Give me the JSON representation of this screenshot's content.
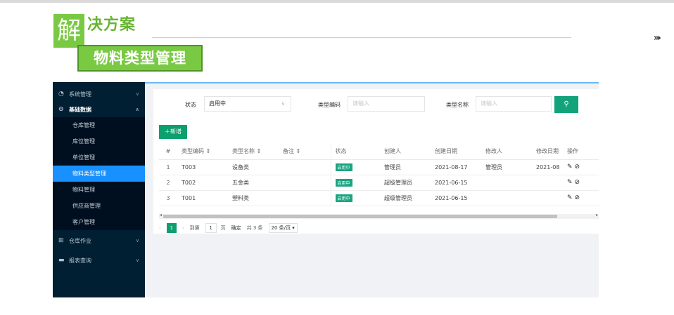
{
  "header": {
    "title_first_char": "解",
    "title_rest": "决方案",
    "subtitle": "物料类型管理",
    "expand_glyph": "»›"
  },
  "sidebar": {
    "groups": [
      {
        "label": "系统管理",
        "icon": "dashboard-icon",
        "expanded": false
      },
      {
        "label": "基础数据",
        "icon": "circle-arrow-icon",
        "expanded": true,
        "items": [
          {
            "label": "仓库管理"
          },
          {
            "label": "库位管理"
          },
          {
            "label": "单位管理"
          },
          {
            "label": "物料类型管理",
            "active": true
          },
          {
            "label": "物料管理"
          },
          {
            "label": "供应商管理"
          },
          {
            "label": "客户管理"
          }
        ]
      },
      {
        "label": "仓库作业",
        "icon": "warehouse-icon",
        "expanded": false
      },
      {
        "label": "报表查询",
        "icon": "chat-icon",
        "expanded": false
      }
    ]
  },
  "filters": {
    "status_label": "状态",
    "status_value": "启用中",
    "code_label": "类型编码",
    "code_placeholder": "请输入",
    "name_label": "类型名称",
    "name_placeholder": "请输入",
    "search_icon": "search-icon"
  },
  "toolbar": {
    "add_label": "新增"
  },
  "table": {
    "columns": {
      "index": "#",
      "code": "类型编码",
      "name": "类型名称",
      "remark": "备注",
      "status": "状态",
      "creator": "创建人",
      "created": "创建日期",
      "modifier": "修改人",
      "modified": "修改日期",
      "ops": "操作"
    },
    "sort_glyph": "⇕",
    "rows": [
      {
        "index": "1",
        "code": "T003",
        "name": "设备类",
        "remark": "",
        "status": "启用中",
        "creator": "管理员",
        "created": "2021-08-17",
        "modifier": "管理员",
        "modified": "2021-08"
      },
      {
        "index": "2",
        "code": "T002",
        "name": "五金类",
        "remark": "",
        "status": "启用中",
        "creator": "超级管理员",
        "created": "2021-06-15",
        "modifier": "",
        "modified": ""
      },
      {
        "index": "3",
        "code": "T001",
        "name": "塑料类",
        "remark": "",
        "status": "启用中",
        "creator": "超级管理员",
        "created": "2021-06-15",
        "modifier": "",
        "modified": ""
      }
    ]
  },
  "pagination": {
    "current_page": "1",
    "goto_label": "到第",
    "goto_value": "1",
    "page_suffix": "页",
    "confirm_label": "确定",
    "total": "共 3 条",
    "page_size": "20 条/页"
  },
  "colors": {
    "accent_green": "#7ac943",
    "primary": "#13a37a",
    "sidebar_bg": "#001f33",
    "active_item": "#1890ff"
  }
}
